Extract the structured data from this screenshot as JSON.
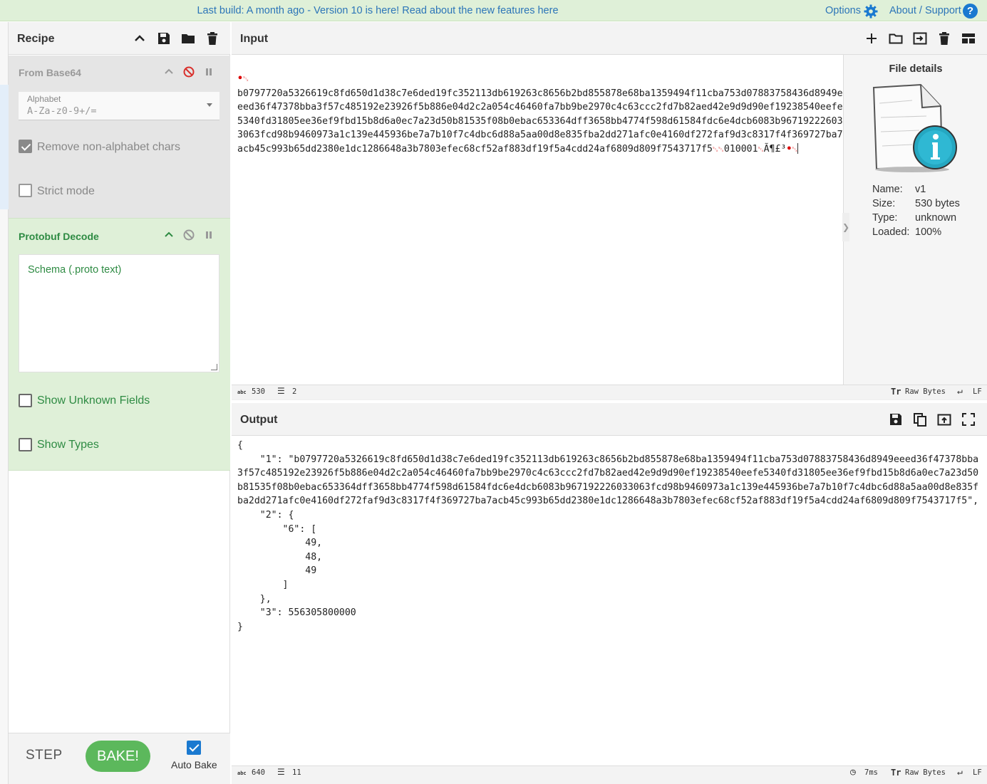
{
  "banner": {
    "message_prefix": "Last build: A month ago - Version 10 is here! Read about the new features ",
    "message_link": "here",
    "options_label": "Options",
    "about_label": "About / Support",
    "help_glyph": "?"
  },
  "recipe": {
    "title": "Recipe",
    "operations": [
      {
        "name": "From Base64",
        "alphabet_label": "Alphabet",
        "alphabet_value": "A-Za-z0-9+/=",
        "remove_non_alphabet_label": "Remove non-alphabet chars",
        "remove_non_alphabet_checked": true,
        "strict_mode_label": "Strict mode",
        "strict_mode_checked": false,
        "disabled": true
      },
      {
        "name": "Protobuf Decode",
        "schema_placeholder": "Schema (.proto text)",
        "show_unknown_label": "Show Unknown Fields",
        "show_unknown_checked": false,
        "show_types_label": "Show Types",
        "show_types_checked": false
      }
    ],
    "step_label": "STEP",
    "bake_label": "BAKE!",
    "auto_bake_label": "Auto Bake",
    "auto_bake_checked": true
  },
  "input": {
    "title": "Input",
    "hex_body": "b0797720a5326619c8fd650d1d38c7e6ded19fc352113db619263c8656b2bd855878e68ba1359494f11cba753d07883758436d8949eeed36f47378bba3f57c485192e23926f5b886e04d2c2a054c46460fa7bb9be2970c4c63ccc2fd7b82aed42e9d9d90ef19238540eefe5340fd31805ee36ef9fbd15b8d6a0ec7a23d50b81535f08b0ebac653364dff3658bb4774f598d61584fdc6e4dcb6083b967192226033063fcd98b9460973a1c139e445936be7a7b10f7c4dbc6d88a5aa00d8e835fba2dd271afc0e4160df272faf9d3c8317f4f369727ba7acb45c993b65dd2380e1dc1286648a3b7803efec68cf52af883df19f5a4cdd24af6809d809f7543717f5",
    "mid_text": "010001",
    "tail_text": "Ã¶£³",
    "char_count": "530",
    "line_count": "2",
    "encoding_label": "Raw Bytes",
    "eol_label": "LF"
  },
  "file_details": {
    "title": "File details",
    "name_key": "Name:",
    "name_value": "v1",
    "size_key": "Size:",
    "size_value": "530 bytes",
    "type_key": "Type:",
    "type_value": "unknown",
    "loaded_key": "Loaded:",
    "loaded_value": "100%"
  },
  "output": {
    "title": "Output",
    "json_text": "{\n    \"1\": \"b0797720a5326619c8fd650d1d38c7e6ded19fc352113db619263c8656b2bd855878e68ba1359494f11cba753d07883758436d8949eeed36f47378bba3f57c485192e23926f5b886e04d2c2a054c46460fa7bb9be2970c4c63ccc2fd7b82aed42e9d9d90ef19238540eefe5340fd31805ee36ef9fbd15b8d6a0ec7a23d50b81535f08b0ebac653364dff3658bb4774f598d61584fdc6e4dcb6083b967192226033063fcd98b9460973a1c139e445936be7a7b10f7c4dbc6d88a5aa00d8e835fba2dd271afc0e4160df272faf9d3c8317f4f369727ba7acb45c993b65dd2380e1dc1286648a3b7803efec68cf52af883df19f5a4cdd24af6809d809f7543717f5\",\n    \"2\": {\n        \"6\": [\n            49,\n            48,\n            49\n        ]\n    },\n    \"3\": 556305800000\n}",
    "char_count": "640",
    "line_count": "11",
    "time_label": "7ms",
    "encoding_label": "Raw Bytes",
    "eol_label": "LF"
  }
}
